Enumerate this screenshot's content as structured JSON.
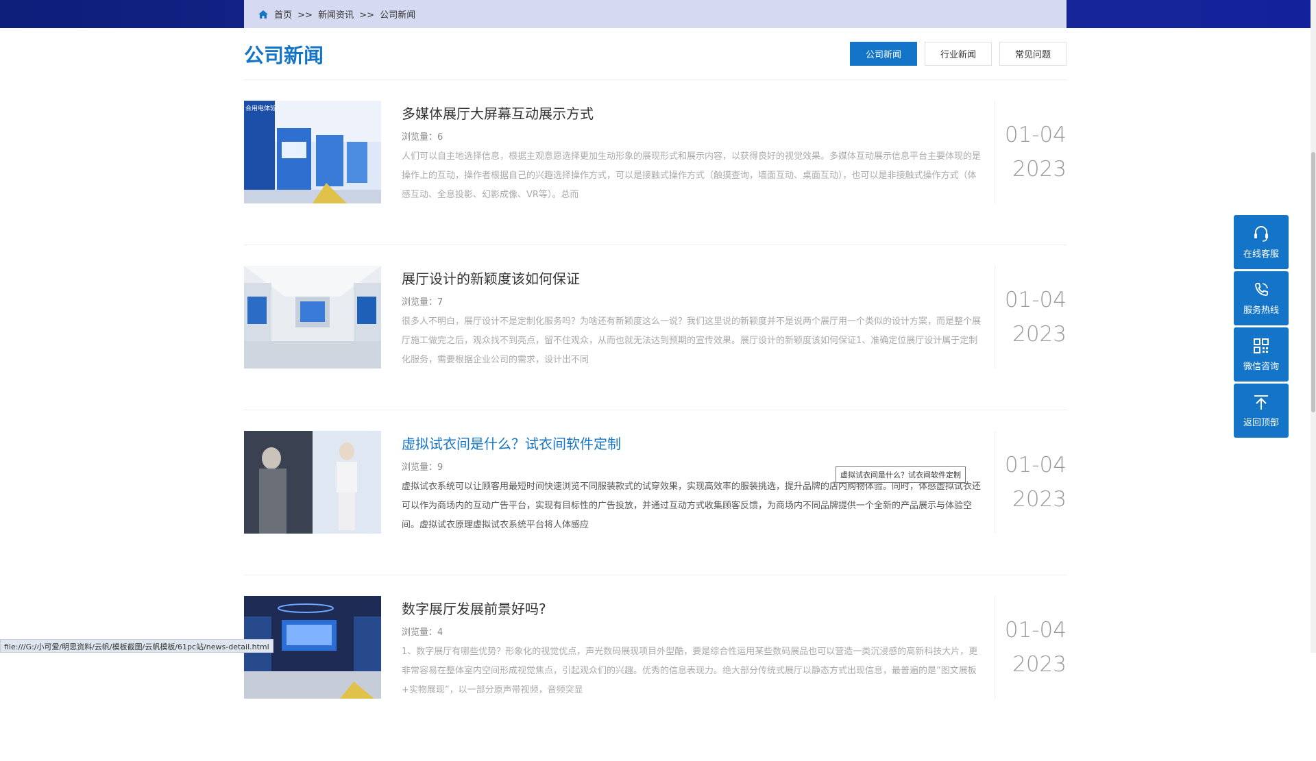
{
  "breadcrumb": {
    "home": "首页",
    "sep1": ">>",
    "level1": "新闻资讯",
    "sep2": ">>",
    "level2": "公司新闻"
  },
  "page_title": "公司新闻",
  "tabs": [
    {
      "label": "公司新闻",
      "active": true
    },
    {
      "label": "行业新闻",
      "active": false
    },
    {
      "label": "常见问题",
      "active": false
    }
  ],
  "news": [
    {
      "title": "多媒体展厅大屏幕互动展示方式",
      "views": "浏览量：6",
      "excerpt": "人们可以自主地选择信息，根据主观意愿选择更加生动形象的展现形式和展示内容，以获得良好的视觉效果。多媒体互动展示信息平台主要体现的是操作上的互动，操作者根据自己的兴趣选择操作方式，可以是接触式操作方式（触摸查询，墙面互动、桌面互动），也可以是非接触式操作方式（体感互动、全息投影、幻影成像、VR等）。总而",
      "date_md": "01-04",
      "date_y": "2023",
      "thumb_text": "合用电体验"
    },
    {
      "title": "展厅设计的新颖度该如何保证",
      "views": "浏览量：7",
      "excerpt": "很多人不明白，展厅设计不是定制化服务吗？为啥还有新颖度这么一说？我们这里说的新颖度并不是说两个展厅用一个类似的设计方案，而是整个展厅施工做完之后，观众找不到亮点，留不住观众，从而也就无法达到预期的宣传效果。展厅设计的新颖度该如何保证1、准确定位展厅设计属于定制化服务，需要根据企业公司的需求，设计出不同",
      "date_md": "01-04",
      "date_y": "2023"
    },
    {
      "title": "虚拟试衣间是什么？试衣间软件定制",
      "views": "浏览量：9",
      "excerpt": "虚拟试衣系统可以让顾客用最短时间快速浏览不同服装款式的试穿效果，实现高效率的服装挑选，提升品牌的店内购物体验。同时，体感虚拟试衣还可以作为商场内的互动广告平台，实现有目标性的广告投放，并通过互动方式收集顾客反馈，为商场内不同品牌提供一个全新的产品展示与体验空间。虚拟试衣原理虚拟试衣系统平台将人体感应",
      "date_md": "01-04",
      "date_y": "2023"
    },
    {
      "title": "数字展厅发展前景好吗?",
      "views": "浏览量：4",
      "excerpt": "1、数字展厅有哪些优势？形象化的视觉优点，声光数码展现项目外型酷，要是综合性运用某些数码展品也可以营造一类沉浸感的高新科技大片，更非常容易在整体室内空间形成视觉焦点，引起观众们的兴趣。优秀的信息表现力。绝大部分传统式展厅以静态方式出现信息，最普遍的是”图文展板+实物展现”，以一部分原声带视频，音频突显",
      "date_md": "01-04",
      "date_y": "2023"
    }
  ],
  "tooltip": "虚拟试衣间是什么？试衣间软件定制",
  "side_buttons": [
    {
      "label": "在线客服",
      "icon": "headset-icon"
    },
    {
      "label": "服务热线",
      "icon": "phone-icon"
    },
    {
      "label": "微信咨询",
      "icon": "qrcode-icon"
    },
    {
      "label": "返回顶部",
      "icon": "arrow-up-icon"
    }
  ],
  "status_url": "file:///G:/小可爱/明思资料/云帆/模板截图/云帆模板/61pc站/news-detail.html",
  "colors": {
    "accent": "#1475c8",
    "topbar": "#13229a"
  }
}
